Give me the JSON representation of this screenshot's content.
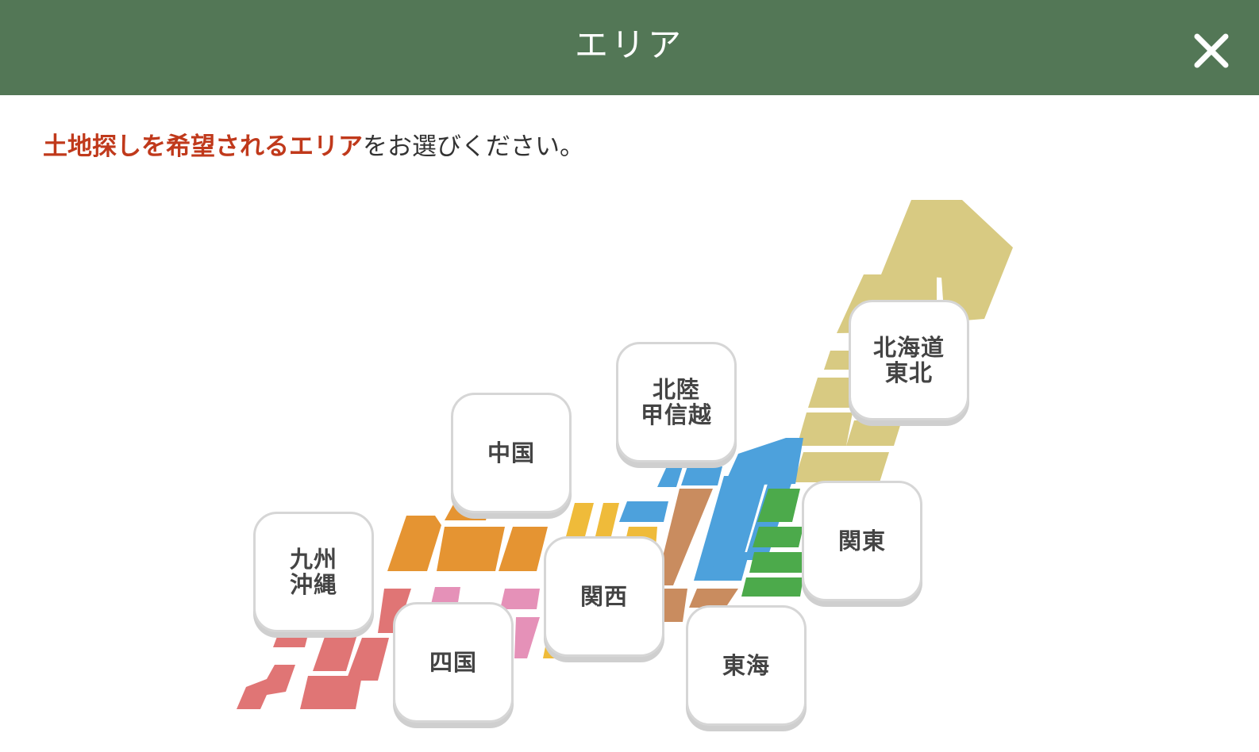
{
  "header": {
    "title": "エリア",
    "color": "#537756"
  },
  "prompt": {
    "highlight": "土地探しを希望されるエリア",
    "rest": "をお選びください。",
    "highlight_color": "#c0391b"
  },
  "regions": {
    "hokkaido_tohoku": {
      "line1": "北海道",
      "line2": "東北",
      "color": "#d8ca82"
    },
    "hokuriku_koshinetsu": {
      "line1": "北陸",
      "line2": "甲信越",
      "color": "#4da1dc"
    },
    "kanto": {
      "line1": "関東",
      "color": "#4caa4b"
    },
    "tokai": {
      "line1": "東海",
      "color": "#c98c5f"
    },
    "kansai": {
      "line1": "関西",
      "color": "#efbb3a"
    },
    "chugoku": {
      "line1": "中国",
      "color": "#e59432"
    },
    "shikoku": {
      "line1": "四国",
      "color": "#e591b8"
    },
    "kyushu_okinawa": {
      "line1": "九州",
      "line2": "沖縄",
      "color": "#e07575"
    }
  }
}
